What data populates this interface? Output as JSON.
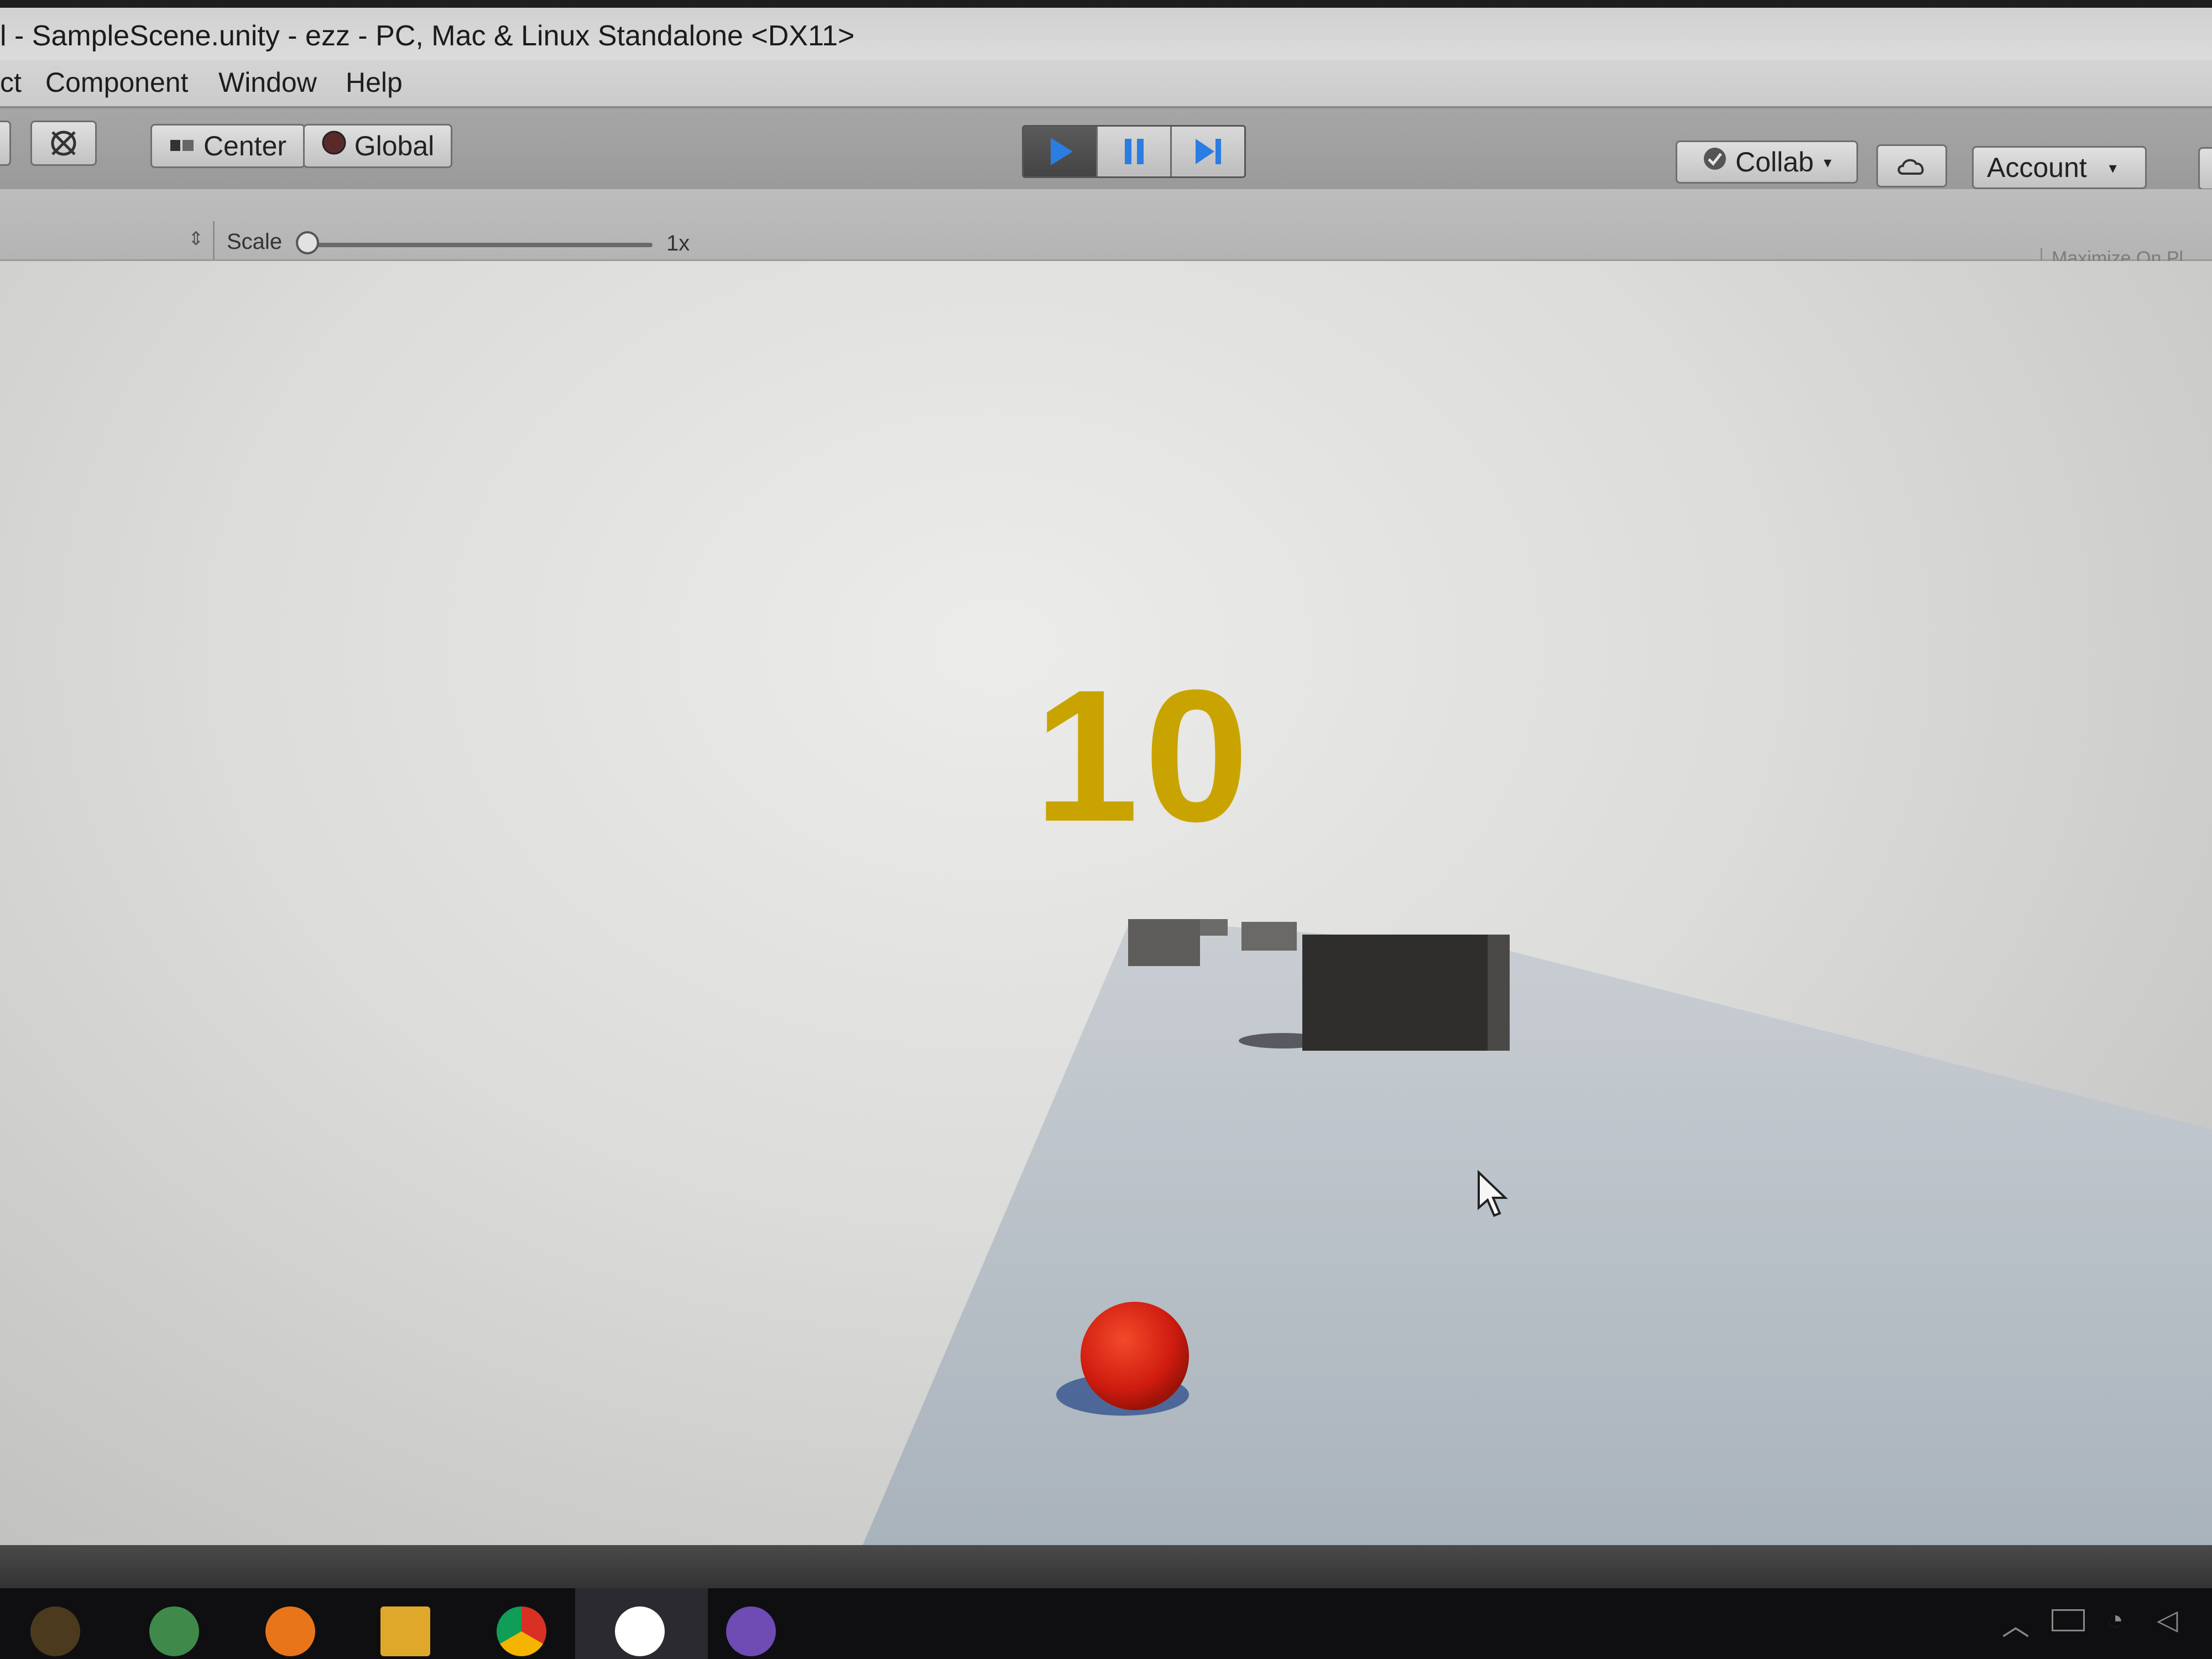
{
  "window": {
    "title": "l - SampleScene.unity - ezz - PC, Mac & Linux Standalone <DX11>"
  },
  "menu": {
    "items": [
      "ct",
      "Component",
      "Window",
      "Help"
    ]
  },
  "toolbar": {
    "pivot_label": "Center",
    "space_label": "Global",
    "collab_label": "Collab",
    "account_label": "Account"
  },
  "game_view": {
    "scale_label": "Scale",
    "scale_value": "1x",
    "maximize_label": "Maximize On Pl",
    "scale_fraction": 0.0
  },
  "game": {
    "score": "10",
    "score_color": "#c9a400",
    "player_color": "#d01c10"
  },
  "taskbar": {
    "apps": [
      "app-icon",
      "android-studio-icon",
      "blender-icon",
      "file-explorer-icon",
      "chrome-icon",
      "unity-icon",
      "github-desktop-icon"
    ]
  }
}
